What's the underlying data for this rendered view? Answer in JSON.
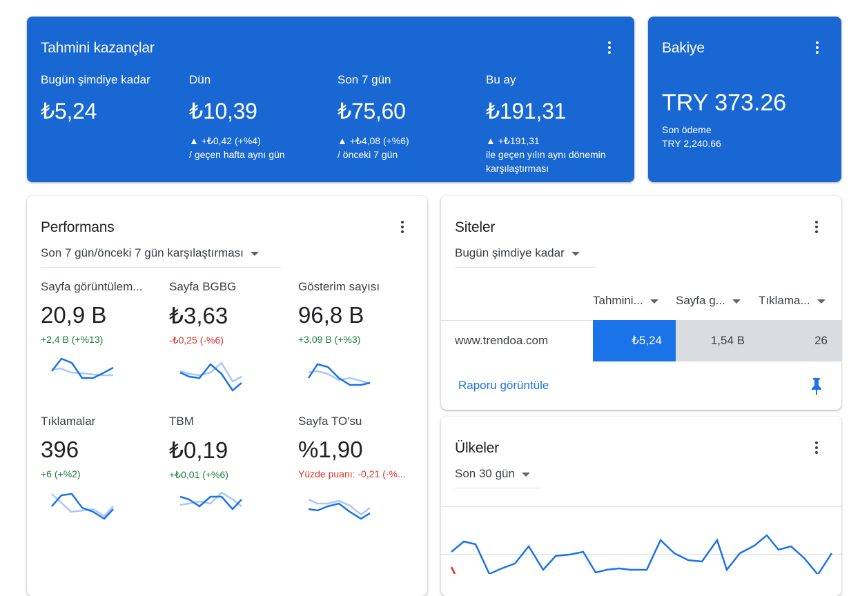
{
  "colors": {
    "primary": "#1967d2",
    "positive": "#188038",
    "negative": "#d93025",
    "sparkline_current": "#1a73e8",
    "sparkline_previous": "#a8c7fa"
  },
  "earnings": {
    "title": "Tahmini kazançlar",
    "menu_icon": "more-vert-icon",
    "kpis": [
      {
        "label": "Bugün şimdiye kadar",
        "value": "₺5,24",
        "change": "",
        "compare": ""
      },
      {
        "label": "Dün",
        "value": "₺10,39",
        "change": "▲ +₺0,42 (+%4)",
        "compare": "/ geçen hafta aynı gün"
      },
      {
        "label": "Son 7 gün",
        "value": "₺75,60",
        "change": "▲ +₺4,08 (+%6)",
        "compare": "/ önceki 7 gün"
      },
      {
        "label": "Bu ay",
        "value": "₺191,31",
        "change": "▲ +₺191,31",
        "compare": "ile geçen yılın aynı dönemin karşılaştırması"
      }
    ]
  },
  "balance": {
    "title": "Bakiye",
    "amount": "TRY 373.26",
    "last_payment_label": "Son ödeme",
    "last_payment_value": "TRY 2,240.66"
  },
  "performance": {
    "title": "Performans",
    "period": "Son 7 gün/önceki 7 gün karşılaştırması",
    "metrics": [
      {
        "label": "Sayfa görüntülem...",
        "value": "20,9 B",
        "change": "+2,4 B (+%13)",
        "trend": "up"
      },
      {
        "label": "Sayfa BGBG",
        "value": "₺3,63",
        "change": "-₺0,25 (-%6)",
        "trend": "down"
      },
      {
        "label": "Gösterim sayısı",
        "value": "96,8 B",
        "change": "+3,09 B (+%3)",
        "trend": "up"
      },
      {
        "label": "Tıklamalar",
        "value": "396",
        "change": "+6 (+%2)",
        "trend": "up"
      },
      {
        "label": "TBM",
        "value": "₺0,19",
        "change": "+₺0,01 (+%6)",
        "trend": "up"
      },
      {
        "label": "Sayfa TO'su",
        "value": "%1,90",
        "change": "Yüzde puanı: -0,21 (-%...",
        "trend": "down"
      }
    ]
  },
  "sites": {
    "title": "Siteler",
    "period": "Bugün şimdiye kadar",
    "columns": [
      "Tahmini...",
      "Sayfa g...",
      "Tıklama..."
    ],
    "rows": [
      {
        "site": "www.trendoa.com",
        "earnings": "₺5,24",
        "pageviews": "1,54 B",
        "clicks": "26"
      }
    ],
    "report_link": "Raporu görüntüle",
    "pin_icon": "pin-icon"
  },
  "countries": {
    "title": "Ülkeler",
    "period": "Son 30 gün"
  }
}
